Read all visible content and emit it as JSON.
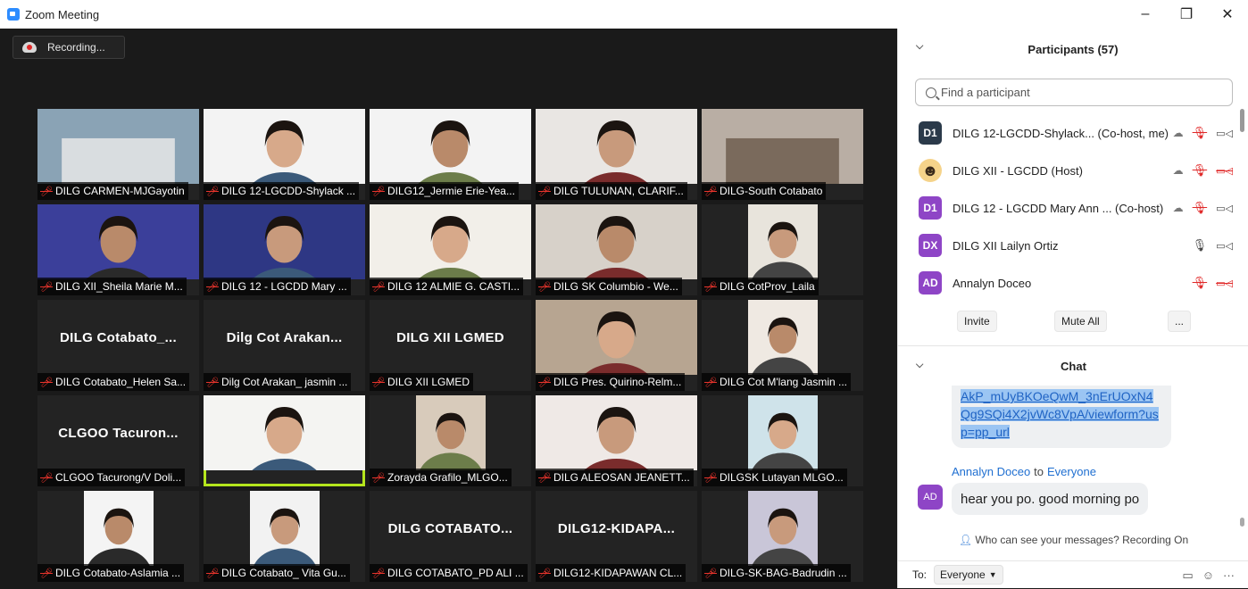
{
  "window": {
    "title": "Zoom Meeting",
    "minimize": "–",
    "maximize": "❐",
    "close": "✕"
  },
  "recording": {
    "label": "Recording..."
  },
  "tiles": [
    {
      "label": "DILG CARMEN-MJGayotin",
      "muted": true,
      "kind": "cam",
      "bg": "#8aa3b5",
      "scene": "building"
    },
    {
      "label": "DILG 12-LGCDD-Shylack ...",
      "muted": true,
      "kind": "cam",
      "bg": "#f3f3f3",
      "scene": "person-dilg"
    },
    {
      "label": "DILG12_Jermie Erie-Yea...",
      "muted": true,
      "kind": "cam",
      "bg": "#f3f3f3",
      "scene": "dark-figure"
    },
    {
      "label": "DILG TULUNAN, CLARIF...",
      "muted": true,
      "kind": "cam",
      "bg": "#e9e6e3",
      "scene": "person-office"
    },
    {
      "label": "DILG-South Cotabato",
      "muted": true,
      "kind": "cam",
      "bg": "#b9aea4",
      "scene": "room"
    },
    {
      "label": "DILG XII_Sheila Marie M...",
      "muted": true,
      "kind": "cam",
      "bg": "#3b3f9a",
      "scene": "person-blue"
    },
    {
      "label": "DILG 12 - LGCDD Mary ...",
      "muted": true,
      "kind": "cam",
      "bg": "#2e3784",
      "scene": "person-green"
    },
    {
      "label": "DILG 12 ALMIE G. CASTI...",
      "muted": true,
      "kind": "cam",
      "bg": "#f2efe9",
      "scene": "person-angat"
    },
    {
      "label": "DILG SK Columbio - We...",
      "muted": true,
      "kind": "cam",
      "bg": "#d7d1c9",
      "scene": "person-hijab"
    },
    {
      "label": "DILG CotProv_Laila",
      "muted": true,
      "kind": "portrait",
      "bg": "#e8e4dc",
      "scene": "standing"
    },
    {
      "label": "DILG Cotabato_Helen Sa...",
      "muted": true,
      "kind": "name",
      "title": "DILG  Cotabato_..."
    },
    {
      "label": "Dilg Cot Arakan_ jasmin ...",
      "muted": true,
      "kind": "name",
      "title": "Dilg Cot Arakan..."
    },
    {
      "label": "DILG XII LGMED",
      "muted": true,
      "kind": "name",
      "title": "DILG XII LGMED"
    },
    {
      "label": "DILG Pres. Quirino-Relm...",
      "muted": true,
      "kind": "cam",
      "bg": "#b7a591",
      "scene": "person-glasses"
    },
    {
      "label": "DILG Cot M'lang Jasmin ...",
      "muted": true,
      "kind": "portrait",
      "bg": "#efe9e2",
      "scene": "mask"
    },
    {
      "label": "CLGOO Tacurong/V Doli...",
      "muted": true,
      "kind": "name",
      "title": "CLGOO  Tacuron..."
    },
    {
      "label": "",
      "muted": false,
      "kind": "cam",
      "bg": "#f4f4f2",
      "scene": "speaker",
      "speaking": true
    },
    {
      "label": "Zorayda Grafilo_MLGO...",
      "muted": true,
      "kind": "portrait",
      "bg": "#d8cbbb",
      "scene": "headset"
    },
    {
      "label": "DILG ALEOSAN JEANETT...",
      "muted": true,
      "kind": "cam",
      "bg": "#efe9e6",
      "scene": "person-dilg2"
    },
    {
      "label": "DILGSK Lutayan  MLGO...",
      "muted": true,
      "kind": "portrait",
      "bg": "#cfe3ea",
      "scene": "woman-window"
    },
    {
      "label": "DILG Cotabato-Aslamia ...",
      "muted": true,
      "kind": "portrait",
      "bg": "#f4f4f4",
      "scene": "hijab-photo"
    },
    {
      "label": "DILG Cotabato_ Vita Gu...",
      "muted": true,
      "kind": "portrait",
      "bg": "#f2f2f2",
      "scene": "mask2"
    },
    {
      "label": "DILG COTABATO_PD ALI ...",
      "muted": true,
      "kind": "name",
      "title": "DILG  COTABATO..."
    },
    {
      "label": "DILG12-KIDAPAWAN CL...",
      "muted": true,
      "kind": "name",
      "title": "DILG12-KIDAPA..."
    },
    {
      "label": "DILG-SK-BAG-Badrudin ...",
      "muted": true,
      "kind": "portrait",
      "bg": "#c9c6d8",
      "scene": "man-suit"
    }
  ],
  "participants": {
    "title": "Participants (57)",
    "search_placeholder": "Find a participant",
    "list": [
      {
        "initials": "D1",
        "color": "#2b3a4a",
        "name": "DILG 12-LGCDD-Shylack...  (Co-host, me)",
        "cloud": true,
        "mic_muted": true,
        "cam": "on"
      },
      {
        "initials": "",
        "color": "#f5d38a",
        "name": "DILG XII - LGCDD (Host)",
        "cloud": true,
        "mic_muted": true,
        "cam": "off",
        "emoji": true
      },
      {
        "initials": "D1",
        "color": "#8e45c6",
        "name": "DILG 12 - LGCDD Mary Ann ...  (Co-host)",
        "cloud": true,
        "mic_muted": true,
        "cam": "on"
      },
      {
        "initials": "DX",
        "color": "#8e45c6",
        "name": "DILG XII Lailyn Ortiz",
        "cloud": false,
        "mic_muted": false,
        "cam": "on"
      },
      {
        "initials": "AD",
        "color": "#8e45c6",
        "name": "Annalyn Doceo",
        "cloud": false,
        "mic_muted": true,
        "cam": "off"
      }
    ],
    "invite": "Invite",
    "mute_all": "Mute All",
    "more": "..."
  },
  "chat": {
    "title": "Chat",
    "link_text": "AkP_mUyBKOeQwM_3nErUOxN4Qg9SQi4X2jvWc8VpA/viewform?usp=pp_url",
    "sender": "Annalyn Doceo",
    "to_word": "to",
    "recipient": "Everyone",
    "avatar_initials": "AD",
    "message": "hear you po. good morning po",
    "visibility": "Who can see your messages? Recording On",
    "to_label": "To:",
    "to_value": "Everyone"
  }
}
